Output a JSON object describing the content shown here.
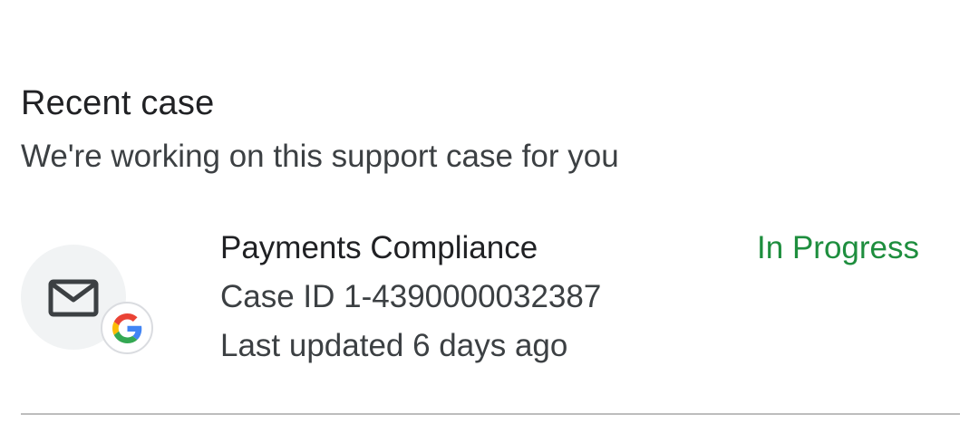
{
  "section": {
    "title": "Recent case",
    "subtitle": "We're working on this support case for you"
  },
  "case": {
    "title": "Payments Compliance",
    "case_id": "Case ID 1-4390000032387",
    "last_updated": "Last updated 6 days ago",
    "status": "In Progress",
    "status_color": "#1e8e3e",
    "icon": "mail-icon",
    "badge_icon": "google-g-icon"
  },
  "colors": {
    "google_blue": "#4285F4",
    "google_red": "#EA4335",
    "google_yellow": "#FBBC05",
    "google_green": "#34A853"
  }
}
